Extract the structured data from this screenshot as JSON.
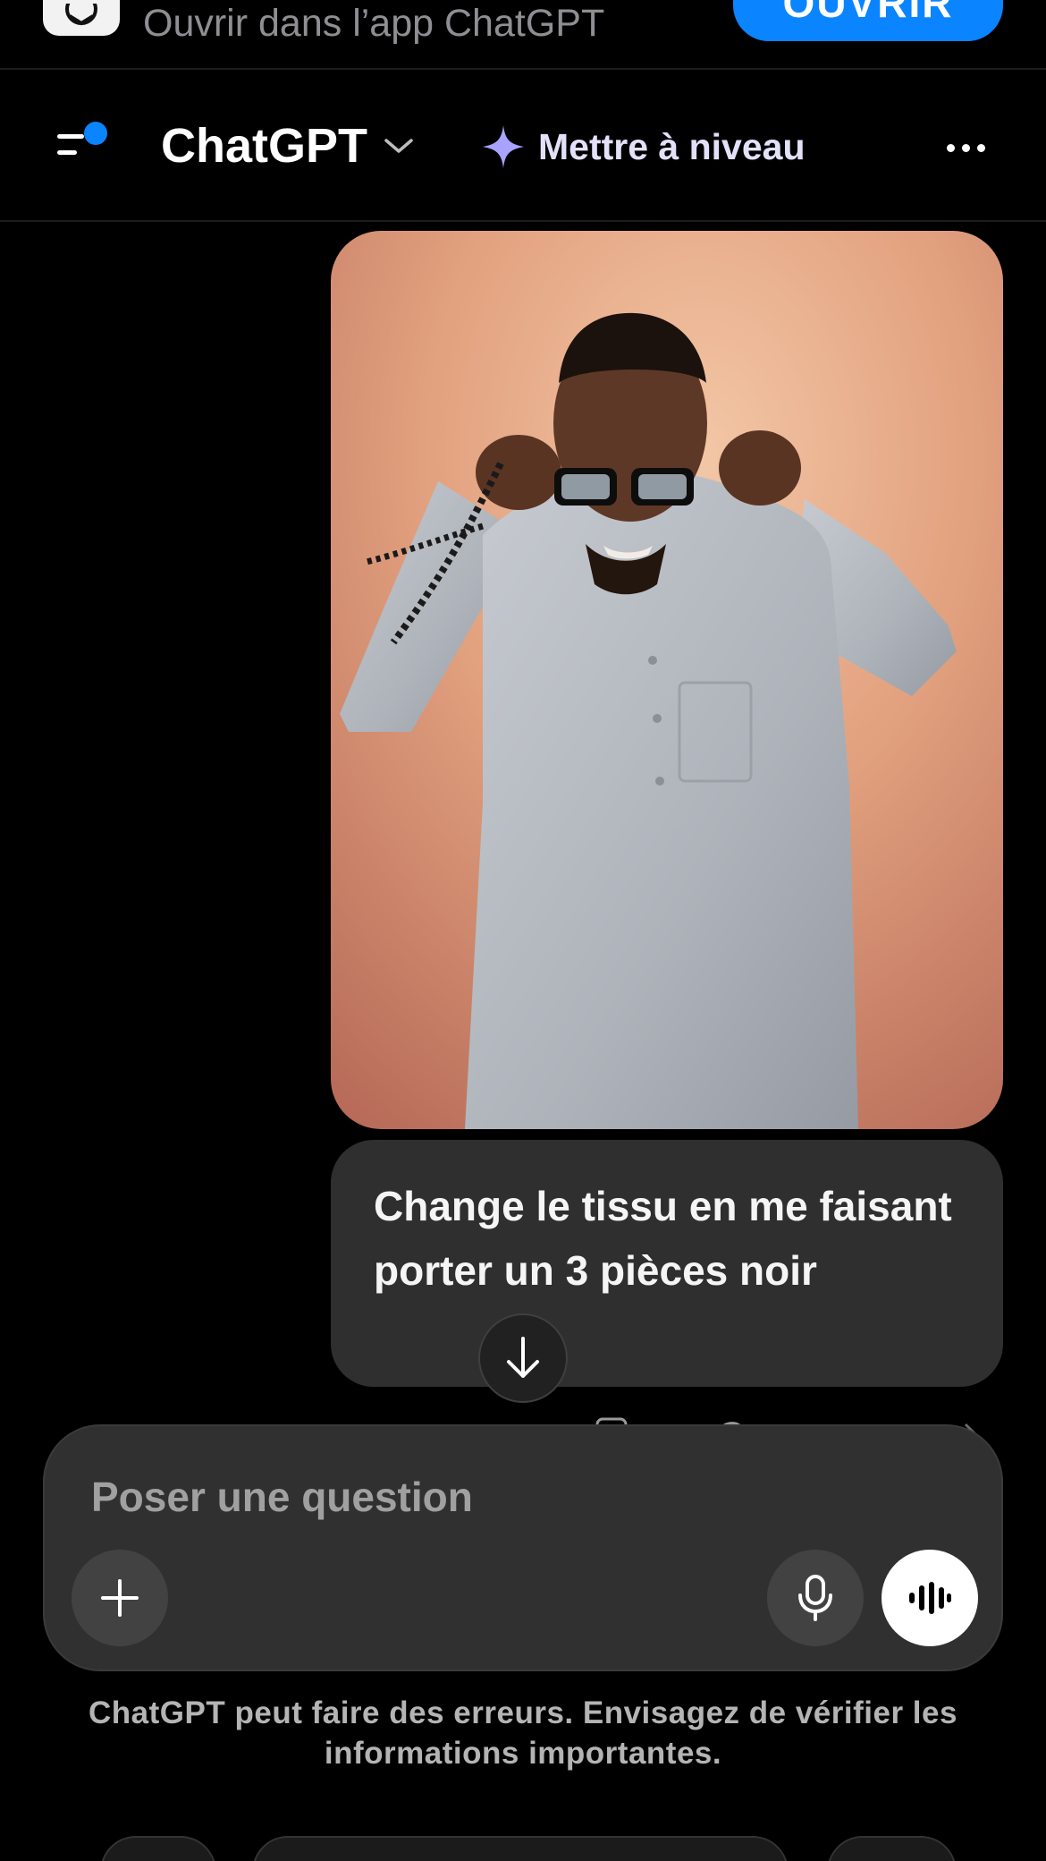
{
  "app_banner": {
    "text": "Ouvrir dans l’app ChatGPT",
    "open_label": "OUVRIR",
    "icon": "openai-logo-icon"
  },
  "header": {
    "model_title": "ChatGPT",
    "upgrade_label": "Mettre à niveau",
    "icons": [
      "sidebar-menu-icon",
      "chevron-down-icon",
      "sparkle-icon",
      "more-horizontal-icon"
    ]
  },
  "conversation": {
    "user_message": "Change le tissu en me faisant porter un 3 pièces noir"
  },
  "composer": {
    "placeholder": "Poser une question",
    "icons": [
      "plus-icon",
      "microphone-icon",
      "voice-mode-icon"
    ]
  },
  "disclaimer": {
    "line1": "ChatGPT peut faire des erreurs. Envisagez de vérifier les",
    "line2": "informations importantes."
  },
  "colors": {
    "background": "#000000",
    "accent": "#0a84ff",
    "bubble": "#2f2f2f",
    "composer": "#303030"
  }
}
